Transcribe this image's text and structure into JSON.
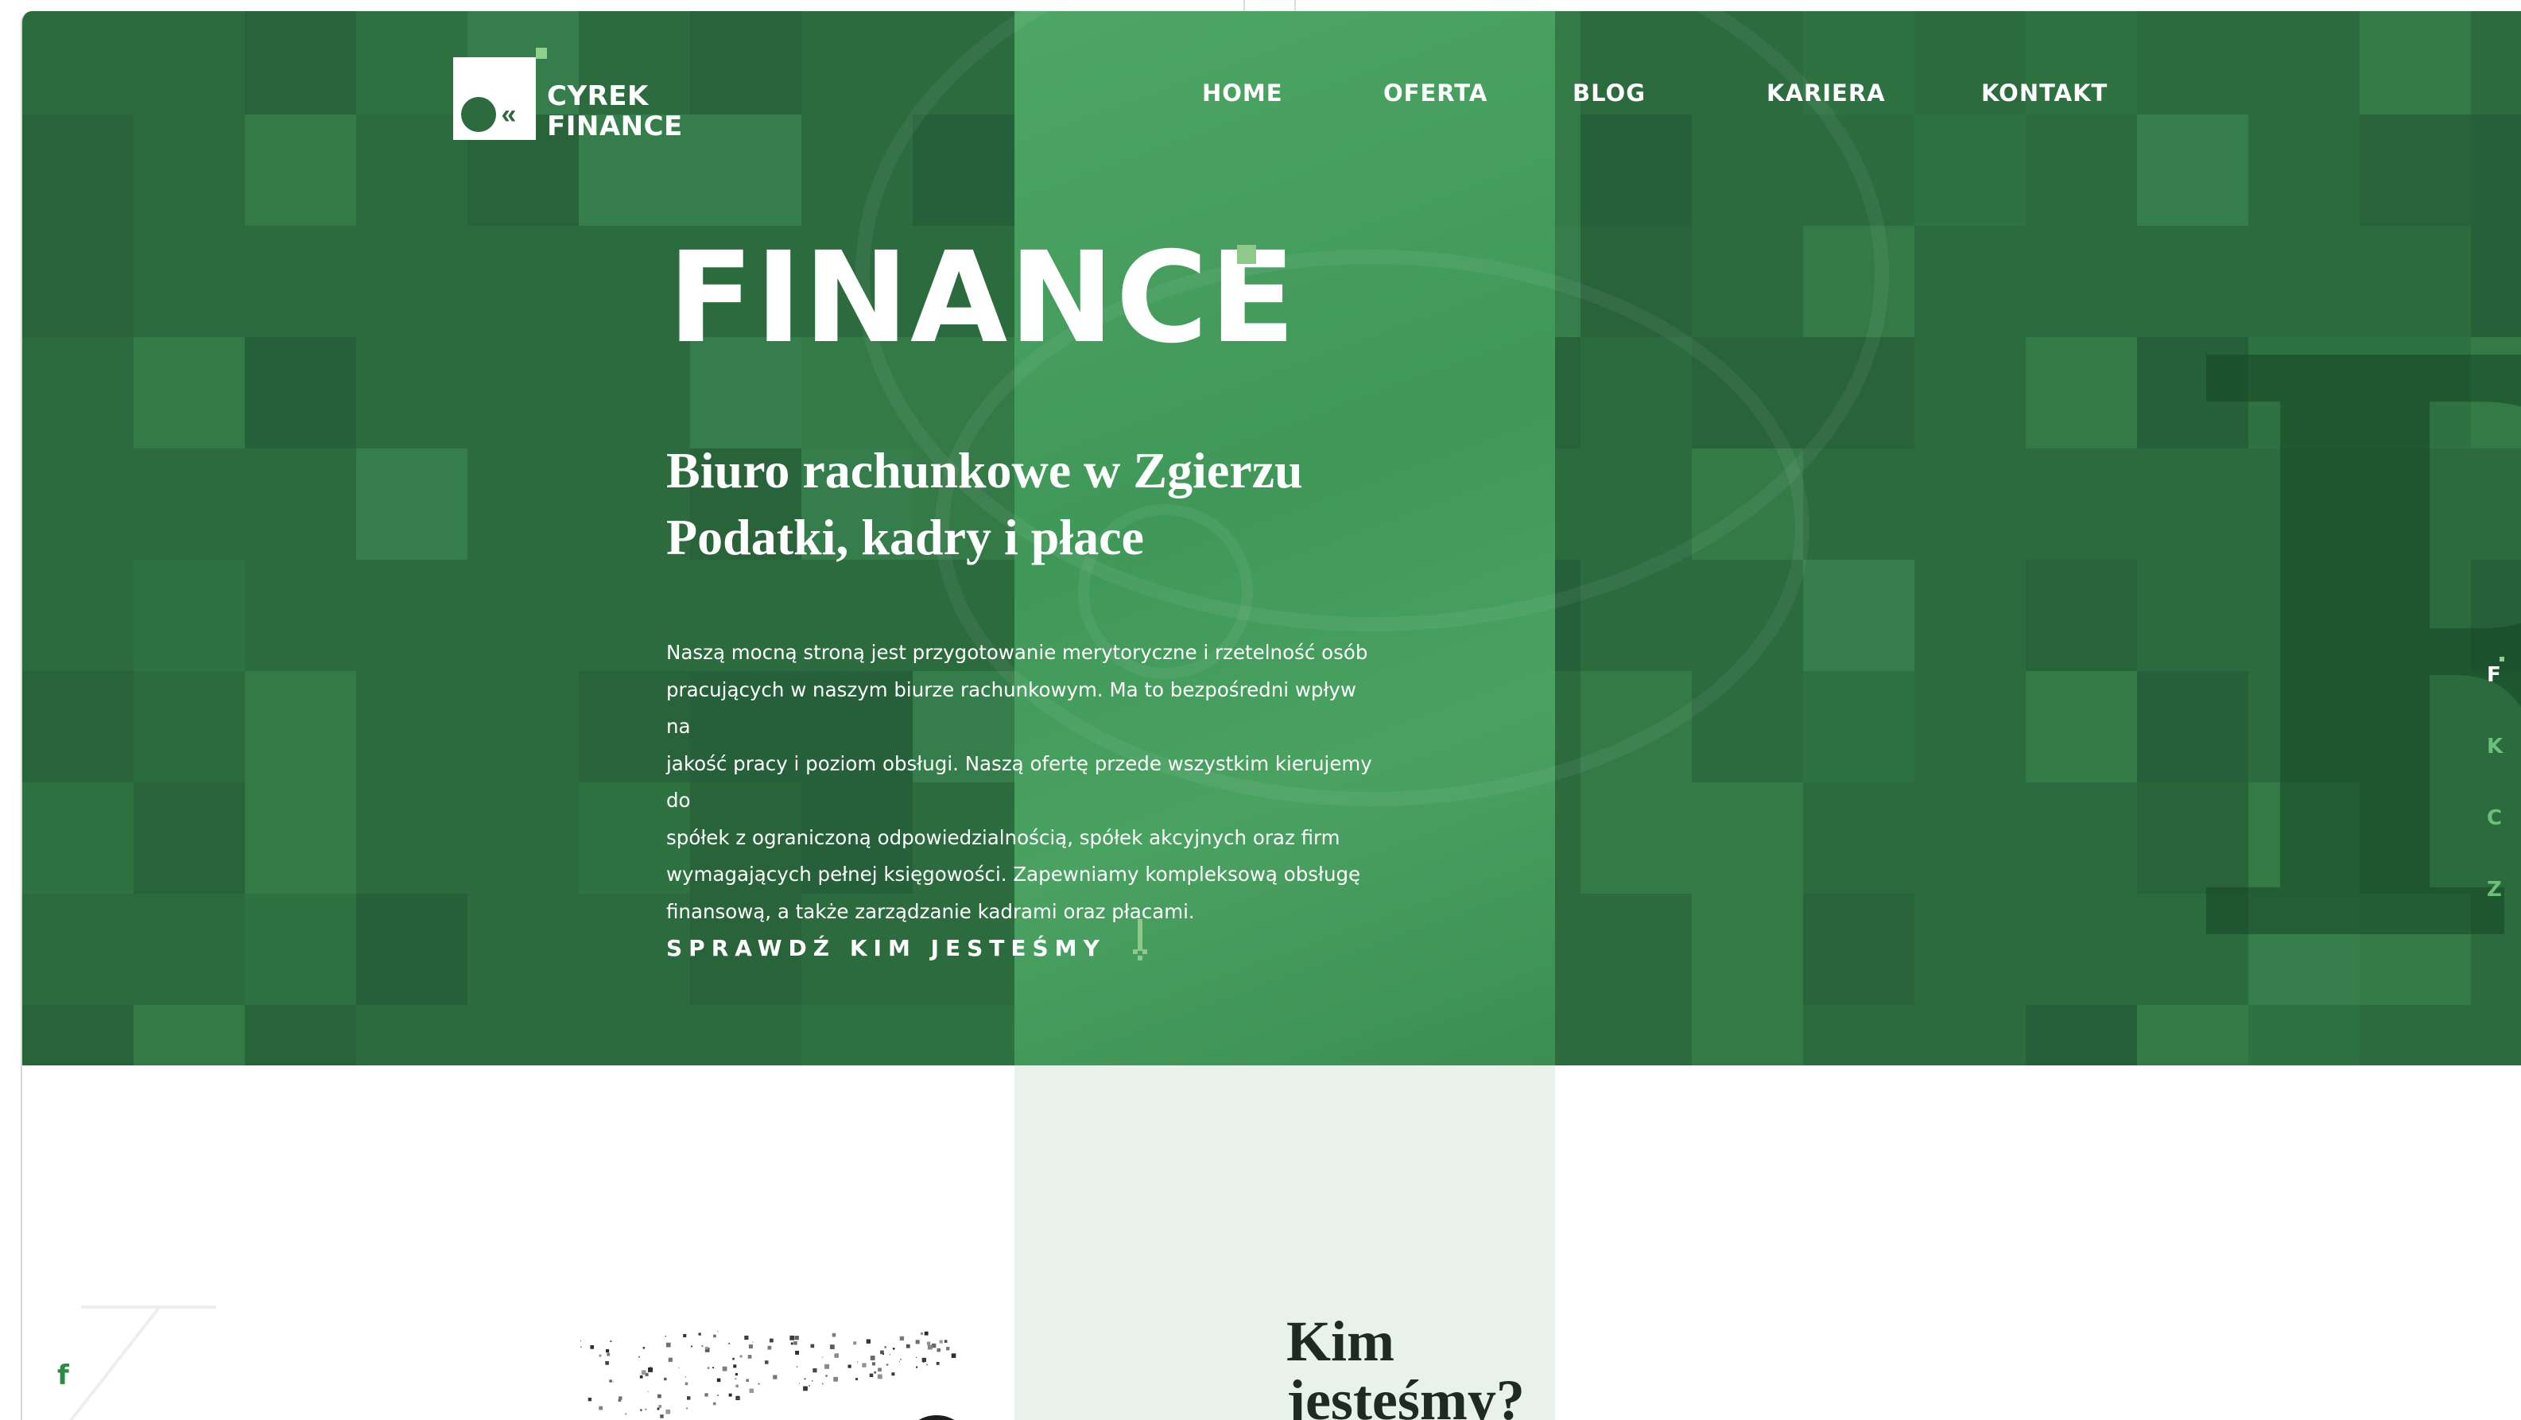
{
  "brand": {
    "logo_line1": "CYREK",
    "logo_line2": "FINANCE"
  },
  "nav": {
    "items": [
      {
        "label": "HOME"
      },
      {
        "label": "OFERTA"
      },
      {
        "label": "BLOG"
      },
      {
        "label": "KARIERA"
      },
      {
        "label": "KONTAKT"
      }
    ]
  },
  "hero": {
    "title": "FINANCE",
    "subtitle_line1": "Biuro rachunkowe w Zgierzu",
    "subtitle_line2": "Podatki, kadry i płace",
    "paragraph_lines": [
      "Naszą mocną stroną jest przygotowanie merytoryczne i rzetelność osób",
      "pracujących w naszym biurze rachunkowym. Ma to bezpośredni wpływ na",
      "jakość pracy i poziom obsługi. Naszą ofertę przede wszystkim kierujemy do",
      "spółek z ograniczoną odpowiedzialnością, spółek akcyjnych oraz firm",
      "wymagających pełnej księgowości. Zapewniamy kompleksową obsługę",
      "finansową, a także zarządzanie kadrami oraz płacami."
    ],
    "cta_label": "SPRAWDŹ KIM JESTEŚMY"
  },
  "side_rail": {
    "items": [
      "F",
      "K",
      "C",
      "Z"
    ],
    "active": "F"
  },
  "about": {
    "heading_line1": "Kim",
    "heading_line2": "jesteśmy?"
  },
  "social": {
    "facebook_glyph": "f"
  },
  "colors": {
    "hero_green": "#2b6b3e",
    "band_green": "#45a05e",
    "accent_light_green": "#8fc98a",
    "lower_band": "#e8f1ea",
    "heading_dark": "#1d2b24"
  },
  "icons": {
    "logo": "cyrek-finance-logo-mark",
    "cta_arrow": "down-arrow-icon",
    "facebook": "facebook-icon"
  }
}
